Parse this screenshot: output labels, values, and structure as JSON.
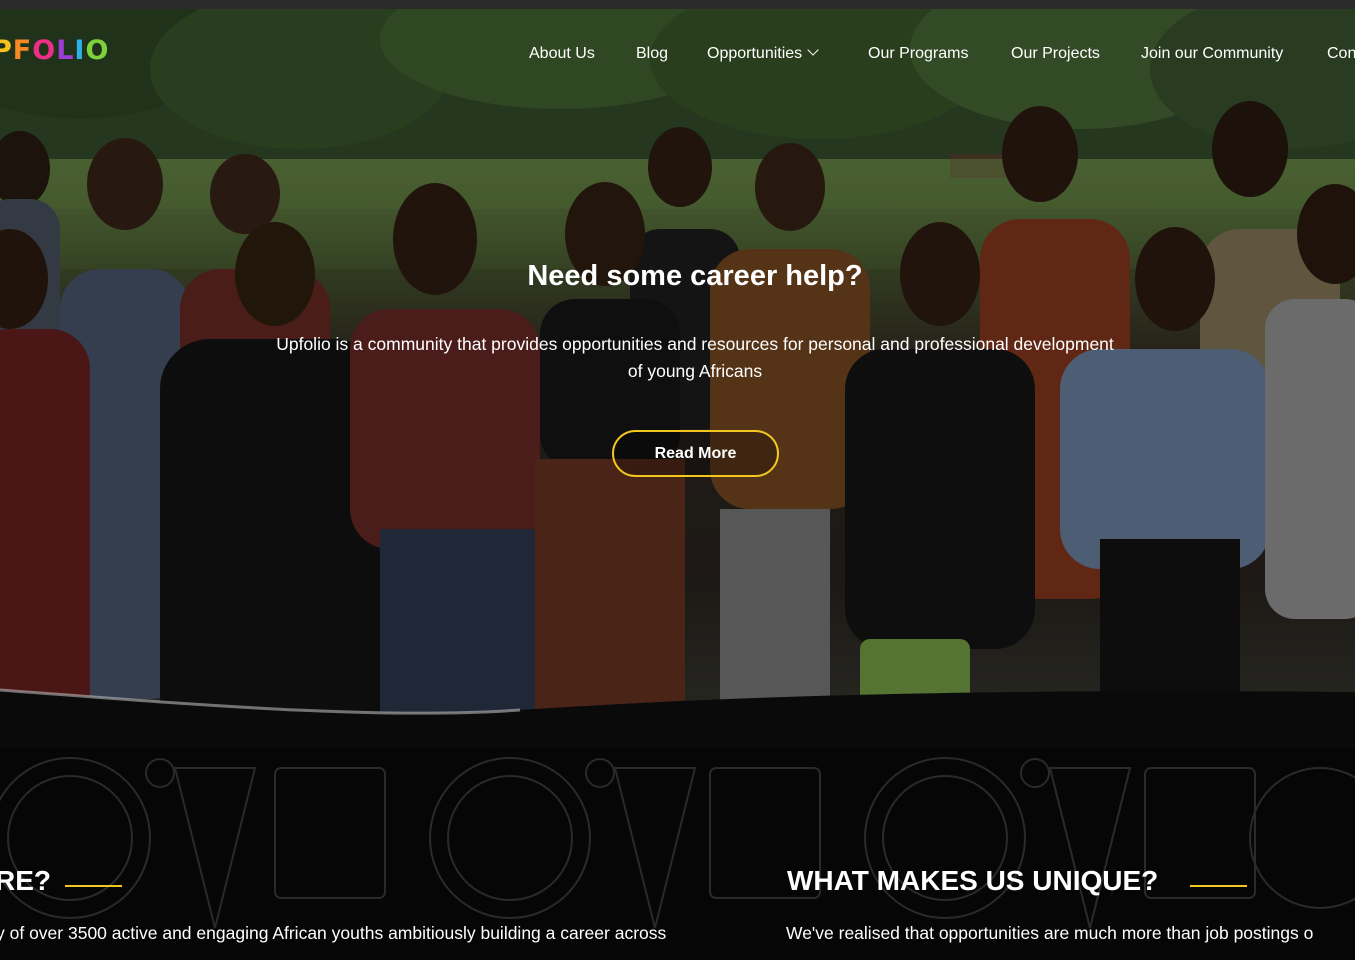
{
  "brand": {
    "logo_letters": [
      "P",
      "F",
      "O",
      "L",
      "I",
      "O"
    ]
  },
  "nav": {
    "items": [
      {
        "label": "About Us"
      },
      {
        "label": "Blog"
      },
      {
        "label": "Opportunities"
      },
      {
        "label": "Our Programs"
      },
      {
        "label": "Our Projects"
      },
      {
        "label": "Join our Community"
      },
      {
        "label": "Con"
      }
    ]
  },
  "hero": {
    "title": "Need some career help?",
    "subtitle": "Upfolio is a community that provides opportunities and resources for personal and professional development of young Africans",
    "cta_label": "Read More"
  },
  "sections": [
    {
      "heading": "RE?",
      "text": "y of over 3500 active and engaging African youths ambitiously building a career across"
    },
    {
      "heading": "WHAT MAKES US UNIQUE?",
      "text": "We've realised that opportunities are much more than job postings o"
    }
  ],
  "colors": {
    "accent": "#f1c61f",
    "background": "#060606"
  }
}
